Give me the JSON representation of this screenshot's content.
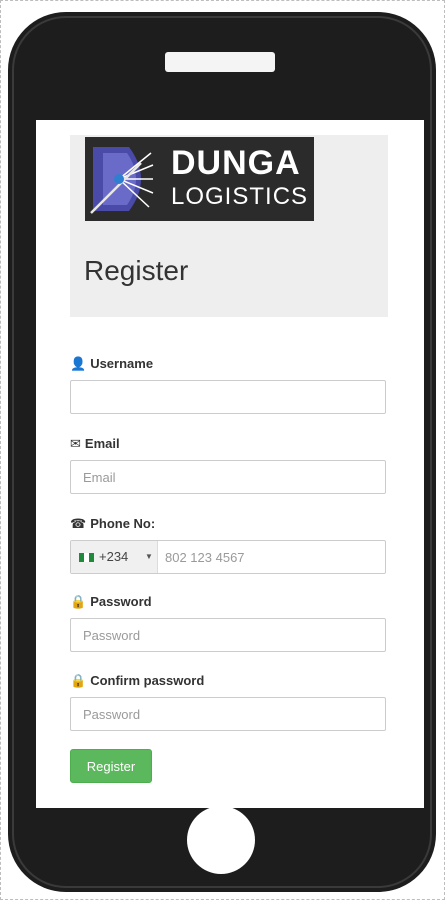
{
  "brand": {
    "name": "DUNGA",
    "subtitle": "LOGISTICS"
  },
  "page": {
    "title": "Register"
  },
  "form": {
    "username": {
      "icon": "user-icon",
      "label": "Username",
      "value": "",
      "placeholder": ""
    },
    "email": {
      "icon": "envelope-icon",
      "label": "Email",
      "placeholder": "Email"
    },
    "phone": {
      "icon": "phone-icon",
      "label": "Phone No:",
      "dial_code": "+234",
      "country_flag": "nigeria-flag-icon",
      "placeholder": "802 123 4567"
    },
    "password": {
      "icon": "lock-icon",
      "label": "Password",
      "placeholder": "Password"
    },
    "confirm_password": {
      "icon": "lock-icon",
      "label": "Confirm password",
      "placeholder": "Password"
    },
    "submit_label": "Register"
  },
  "colors": {
    "phone_body": "#1d1d1d",
    "header_panel": "#eeeeee",
    "logo_bg": "#2b2b2b",
    "accent_green": "#5cb85c",
    "flag_green": "#1f8a3c"
  }
}
